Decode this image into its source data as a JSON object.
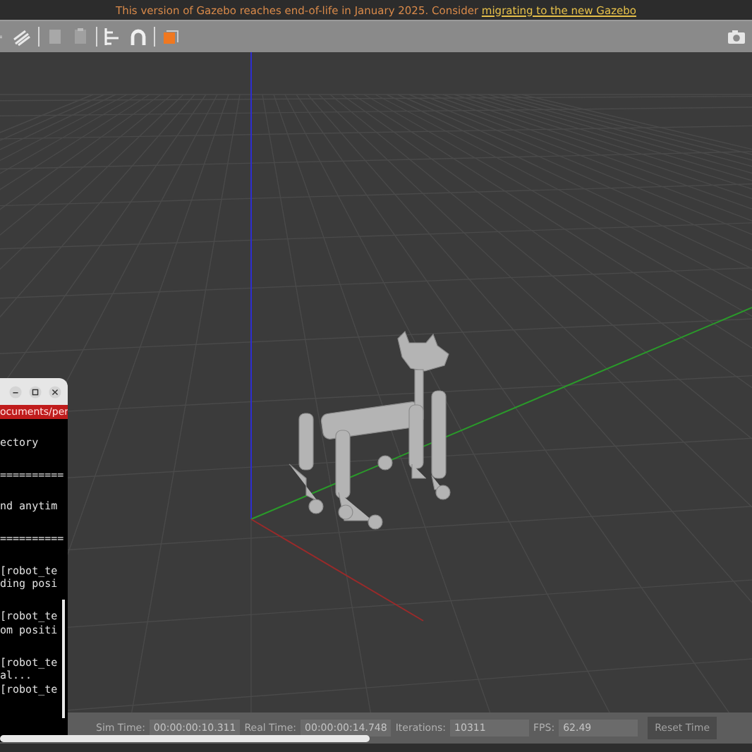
{
  "banner": {
    "text": "This version of Gazebo reaches end-of-life in January 2025. Consider ",
    "link": "migrating to the new Gazebo"
  },
  "terminal": {
    "path": "ocuments/per",
    "blocks": [
      [
        "ectory"
      ],
      [
        "=========="
      ],
      [
        "nd anytim"
      ],
      [
        "=========="
      ],
      [
        "[robot_te",
        "ding posi"
      ],
      [
        "[robot_te",
        "om positi"
      ],
      [
        "[robot_te",
        "al...",
        "[robot_te"
      ]
    ]
  },
  "status_bar": {
    "fields": [
      {
        "label": "Sim Time:",
        "value": "00:00:00:10.311"
      },
      {
        "label": "Real Time:",
        "value": "00:00:00:14.748"
      },
      {
        "label": "Iterations:",
        "value": "10311"
      },
      {
        "label": "FPS:",
        "value": "62.49"
      }
    ],
    "button": "Reset Time"
  }
}
